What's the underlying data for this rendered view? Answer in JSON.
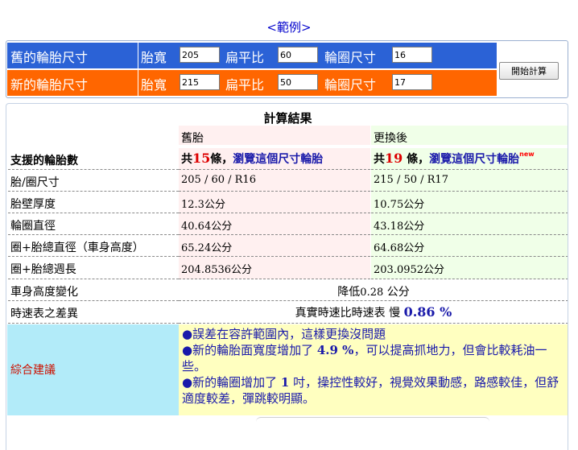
{
  "example_link": "<範例>",
  "inputs": {
    "old": {
      "label": "舊的輪胎尺寸",
      "width_label": "胎寬",
      "width_value": "205",
      "aspect_label": "扁平比",
      "aspect_value": "60",
      "rim_label": "輪圈尺寸",
      "rim_value": "16"
    },
    "new": {
      "label": "新的輪胎尺寸",
      "width_label": "胎寬",
      "width_value": "215",
      "aspect_label": "扁平比",
      "aspect_value": "50",
      "rim_label": "輪圈尺寸",
      "rim_value": "17"
    },
    "calc_button": "開始計算"
  },
  "results": {
    "title": "計算結果",
    "col_old": "舊胎",
    "col_new": "更換後",
    "supported": {
      "label": "支援的輪胎數",
      "old_prefix": "共",
      "old_count": "15",
      "old_suffix": "條，",
      "old_link": "瀏覽這個尺寸輪胎",
      "new_prefix": "共",
      "new_count": "19",
      "new_suffix": " 條，",
      "new_link": "瀏覽這個尺寸輪胎",
      "new_tag": "new"
    },
    "rows": [
      {
        "label": "胎/圈尺寸",
        "old": "205 / 60 / R16",
        "new": "215 / 50 / R17"
      },
      {
        "label": "胎壁厚度",
        "old_num": "12.3",
        "old_unit": "公分",
        "new_num": "10.75",
        "new_unit": "公分"
      },
      {
        "label": "輪圈直徑",
        "old_num": "40.64",
        "old_unit": "公分",
        "new_num": "43.18",
        "new_unit": "公分"
      },
      {
        "label": "圈+胎總直徑（車身高度）",
        "old_num": "65.24",
        "old_unit": "公分",
        "new_num": "64.68",
        "new_unit": "公分"
      },
      {
        "label": "圈+胎總週長",
        "old_num": "204.8536",
        "old_unit": "公分",
        "new_num": "203.0952",
        "new_unit": "公分"
      }
    ],
    "height_change": {
      "label": "車身高度變化",
      "prefix": "降低",
      "value": "0.28",
      "unit": " 公分"
    },
    "speedo": {
      "label": "時速表之差異",
      "prefix": "真實時速比時速表 慢 ",
      "value": "0.86 %"
    },
    "advice": {
      "label": "綜合建議",
      "line1": "●誤差在容許範圍內，這樣更換沒問題",
      "line2_a": "●新的輪胎面寬度增加了 ",
      "line2_v": "4.9 %",
      "line2_b": "，可以提高抓地力，但會比較耗油一些。",
      "line3_a": "●新的輪圈增加了 ",
      "line3_v": "1",
      "line3_b": " 吋，操控性較好，視覺效果動感，路感較佳，但舒適度較差，彈跳較明顯。"
    }
  }
}
